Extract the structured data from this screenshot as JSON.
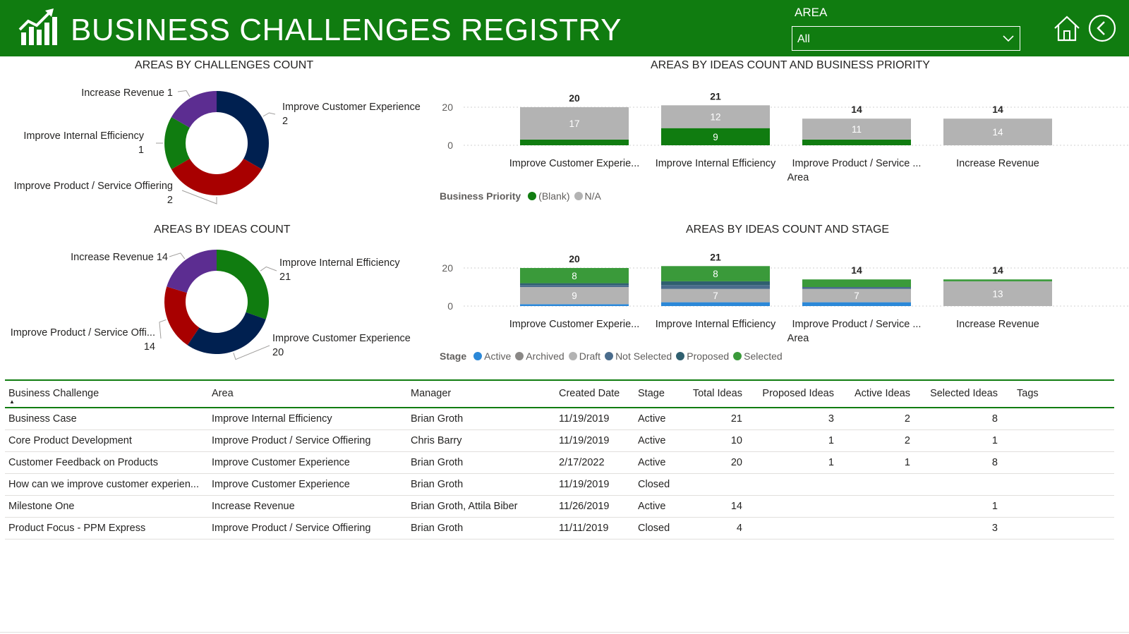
{
  "header": {
    "title": "BUSINESS CHALLENGES REGISTRY",
    "area_filter": {
      "label": "AREA",
      "value": "All"
    },
    "icons": [
      "chart-logo-icon",
      "home-icon",
      "back-icon",
      "chevron-down-icon"
    ]
  },
  "colors": {
    "header_green": "#107c10",
    "navy": "#002050",
    "red": "#a80000",
    "purple": "#5c2d91",
    "green": "#107c10",
    "gray": "#b3b3b3",
    "selected_green": "#3a9a3a",
    "active_blue": "#2b88d8",
    "not_selected": "#4a6c8c",
    "proposed": "#2f5f6f"
  },
  "donut_challenges": {
    "title": "AREAS BY CHALLENGES COUNT",
    "slices": [
      {
        "label": "Improve Customer Experience",
        "value": 2,
        "color": "#002050",
        "label_value": "2"
      },
      {
        "label": "Improve Product / Service Offiering",
        "value": 2,
        "color": "#a80000",
        "label_value": "2"
      },
      {
        "label": "Improve Internal Efficiency",
        "value": 1,
        "color": "#107c10",
        "label_value": "1"
      },
      {
        "label": "Increase Revenue 1",
        "value": 1,
        "color": "#5c2d91",
        "label_value": ""
      }
    ]
  },
  "donut_ideas": {
    "title": "AREAS BY IDEAS COUNT",
    "slices": [
      {
        "label": "Improve Internal Efficiency",
        "value": 21,
        "color": "#107c10",
        "label_value": "21"
      },
      {
        "label": "Improve Customer Experience",
        "value": 20,
        "color": "#002050",
        "label_value": "20"
      },
      {
        "label": "Improve Product / Service Offi...",
        "value": 14,
        "color": "#a80000",
        "label_value": "14"
      },
      {
        "label": "Increase Revenue 14",
        "value": 14,
        "color": "#5c2d91",
        "label_value": ""
      }
    ]
  },
  "chart_data": [
    {
      "type": "bar",
      "title": "AREAS BY IDEAS COUNT AND BUSINESS PRIORITY",
      "xlabel": "Area",
      "categories": [
        "Improve Customer Experie...",
        "Improve Internal Efficiency",
        "Improve Product / Service ...",
        "Increase Revenue"
      ],
      "ylim": [
        0,
        21
      ],
      "yticks": [
        "0",
        "20"
      ],
      "totals": [
        "20",
        "21",
        "14",
        "14"
      ],
      "legend_title": "Business Priority",
      "series": [
        {
          "name": "(Blank)",
          "color": "#107c10",
          "values": [
            3,
            9,
            3,
            0
          ],
          "labels": [
            "",
            "9",
            "",
            ""
          ]
        },
        {
          "name": "N/A",
          "color": "#b3b3b3",
          "values": [
            17,
            12,
            11,
            14
          ],
          "labels": [
            "17",
            "12",
            "11",
            "14"
          ]
        }
      ]
    },
    {
      "type": "bar",
      "title": "AREAS BY IDEAS COUNT AND STAGE",
      "xlabel": "Area",
      "categories": [
        "Improve Customer Experie...",
        "Improve Internal Efficiency",
        "Improve Product / Service ...",
        "Increase Revenue"
      ],
      "ylim": [
        0,
        21
      ],
      "yticks": [
        "0",
        "20"
      ],
      "totals": [
        "20",
        "21",
        "14",
        "14"
      ],
      "legend_title": "Stage",
      "series": [
        {
          "name": "Active",
          "color": "#2b88d8",
          "values": [
            1,
            2,
            2,
            0
          ],
          "labels": [
            "",
            "",
            "",
            ""
          ]
        },
        {
          "name": "Archived",
          "color": "#8a8886",
          "values": [
            0,
            0,
            0,
            0
          ],
          "labels": [
            "",
            "",
            "",
            ""
          ]
        },
        {
          "name": "Draft",
          "color": "#b3b3b3",
          "values": [
            9,
            7,
            7,
            13
          ],
          "labels": [
            "9",
            "7",
            "7",
            "13"
          ]
        },
        {
          "name": "Not Selected",
          "color": "#4a6c8c",
          "values": [
            1,
            2,
            1,
            0
          ],
          "labels": [
            "",
            "",
            "",
            ""
          ]
        },
        {
          "name": "Proposed",
          "color": "#2f5f6f",
          "values": [
            1,
            2,
            0,
            0
          ],
          "labels": [
            "",
            "",
            "",
            ""
          ]
        },
        {
          "name": "Selected",
          "color": "#3a9a3a",
          "values": [
            8,
            8,
            4,
            1
          ],
          "labels": [
            "8",
            "8",
            "",
            ""
          ]
        }
      ]
    }
  ],
  "table": {
    "columns": [
      "Business Challenge",
      "Area",
      "Manager",
      "Created Date",
      "Stage",
      "Total Ideas",
      "Proposed Ideas",
      "Active Ideas",
      "Selected Ideas",
      "Tags"
    ],
    "rows": [
      [
        "Business Case",
        "Improve Internal Efficiency",
        "Brian Groth",
        "11/19/2019",
        "Active",
        "21",
        "3",
        "2",
        "8",
        ""
      ],
      [
        "Core Product Development",
        "Improve Product / Service Offiering",
        "Chris Barry",
        "11/19/2019",
        "Active",
        "10",
        "1",
        "2",
        "1",
        ""
      ],
      [
        "Customer Feedback on Products",
        "Improve Customer Experience",
        "Brian Groth",
        "2/17/2022",
        "Active",
        "20",
        "1",
        "1",
        "8",
        ""
      ],
      [
        "How can we improve customer experien...",
        "Improve Customer Experience",
        "Brian Groth",
        "11/19/2019",
        "Closed",
        "",
        "",
        "",
        "",
        ""
      ],
      [
        "Milestone One",
        "Increase Revenue",
        "Brian Groth, Attila Biber",
        "11/26/2019",
        "Active",
        "14",
        "",
        "",
        "1",
        ""
      ],
      [
        "Product Focus - PPM Express",
        "Improve Product / Service Offiering",
        "Brian Groth",
        "11/11/2019",
        "Closed",
        "4",
        "",
        "",
        "3",
        ""
      ]
    ]
  }
}
